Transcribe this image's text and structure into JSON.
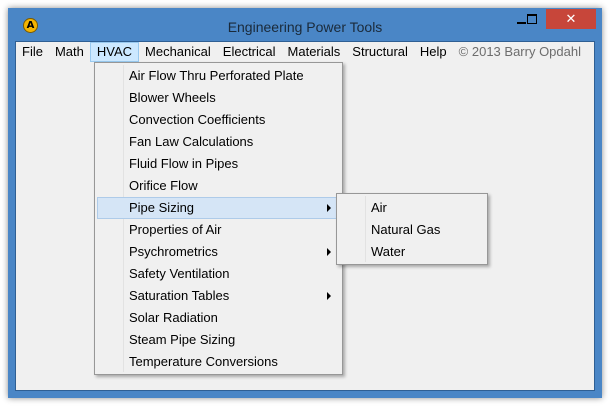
{
  "window": {
    "title": "Engineering Power Tools",
    "icon": "app-logo-icon",
    "icon_glyph": "A",
    "close_glyph": "✕",
    "accent_color": "#4a86c6",
    "close_color": "#c7463a"
  },
  "menubar": {
    "items": [
      "File",
      "Math",
      "HVAC",
      "Mechanical",
      "Electrical",
      "Materials",
      "Structural",
      "Help"
    ],
    "active": "HVAC",
    "copyright": "© 2013 Barry Opdahl"
  },
  "hvac_menu": {
    "items": [
      {
        "label": "Air Flow Thru Perforated Plate",
        "submenu": false
      },
      {
        "label": "Blower Wheels",
        "submenu": false
      },
      {
        "label": "Convection Coefficients",
        "submenu": false
      },
      {
        "label": "Fan Law Calculations",
        "submenu": false
      },
      {
        "label": "Fluid Flow in Pipes",
        "submenu": false
      },
      {
        "label": "Orifice Flow",
        "submenu": false
      },
      {
        "label": "Pipe Sizing",
        "submenu": true
      },
      {
        "label": "Properties of Air",
        "submenu": false
      },
      {
        "label": "Psychrometrics",
        "submenu": true
      },
      {
        "label": "Safety Ventilation",
        "submenu": false
      },
      {
        "label": "Saturation Tables",
        "submenu": true
      },
      {
        "label": "Solar Radiation",
        "submenu": false
      },
      {
        "label": "Steam Pipe Sizing",
        "submenu": false
      },
      {
        "label": "Temperature Conversions",
        "submenu": false
      }
    ],
    "highlighted": "Pipe Sizing"
  },
  "pipe_sizing_menu": {
    "items": [
      "Air",
      "Natural Gas",
      "Water"
    ]
  }
}
